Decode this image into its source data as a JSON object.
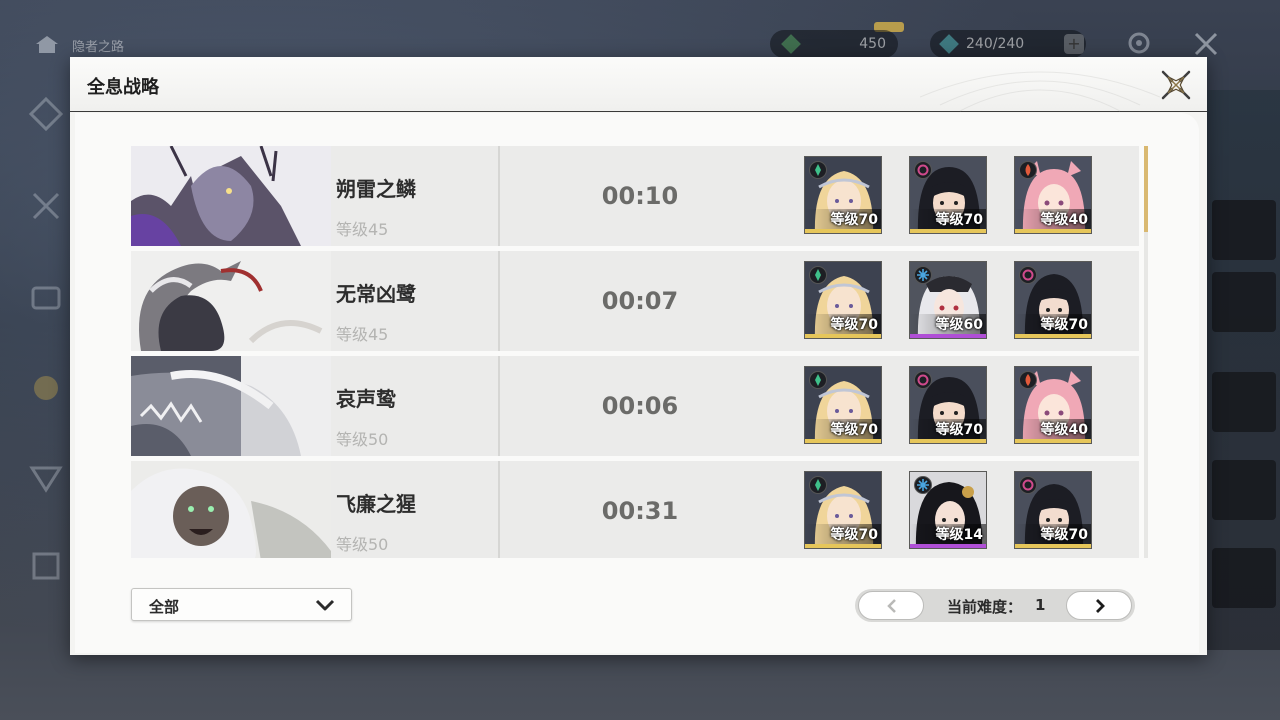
{
  "background": {
    "home_label": "隐者之路",
    "currency_1_value": "450",
    "currency_2_value": "240/240",
    "plus_label": "+"
  },
  "panel": {
    "title": "全息战略"
  },
  "rows": [
    {
      "name": "朔雷之鳞",
      "level": "等级45",
      "time": "00:10",
      "team": [
        {
          "element": "aero",
          "level": "等级70",
          "rarity": "gold"
        },
        {
          "element": "havoc",
          "level": "等级70",
          "rarity": "gold"
        },
        {
          "element": "fusion",
          "level": "等级40",
          "rarity": "gold"
        }
      ]
    },
    {
      "name": "无常凶鹭",
      "level": "等级45",
      "time": "00:07",
      "team": [
        {
          "element": "aero",
          "level": "等级70",
          "rarity": "gold"
        },
        {
          "element": "glacio",
          "level": "等级60",
          "rarity": "purple"
        },
        {
          "element": "havoc",
          "level": "等级70",
          "rarity": "gold"
        }
      ]
    },
    {
      "name": "哀声鸷",
      "level": "等级50",
      "time": "00:06",
      "team": [
        {
          "element": "aero",
          "level": "等级70",
          "rarity": "gold"
        },
        {
          "element": "havoc",
          "level": "等级70",
          "rarity": "gold"
        },
        {
          "element": "fusion",
          "level": "等级40",
          "rarity": "gold"
        }
      ]
    },
    {
      "name": "飞廉之猩",
      "level": "等级50",
      "time": "00:31",
      "team": [
        {
          "element": "aero",
          "level": "等级70",
          "rarity": "gold"
        },
        {
          "element": "glacio",
          "level": "等级14",
          "rarity": "purple"
        },
        {
          "element": "havoc",
          "level": "等级70",
          "rarity": "gold"
        }
      ]
    }
  ],
  "filter": {
    "selected": "全部"
  },
  "pager": {
    "label": "当前难度：",
    "value": "1"
  },
  "colors": {
    "gold": "#e6c65a",
    "purple": "#b04fd6",
    "aero": "#3fc08a",
    "havoc": "#d04a8c",
    "fusion": "#e25a3a",
    "glacio": "#4aa6e0"
  },
  "portraits": {
    "aero": "blonde-hair-portrait-icon",
    "havoc": "black-hair-portrait-icon",
    "fusion": "pink-hair-portrait-icon",
    "glacio": "white-hair-portrait-icon"
  }
}
